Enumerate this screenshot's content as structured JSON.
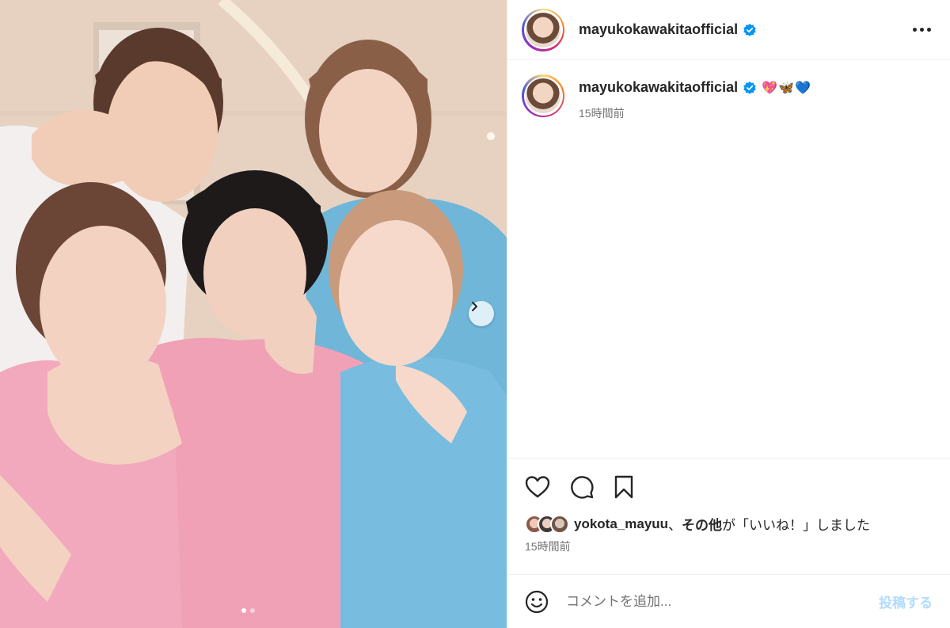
{
  "post": {
    "username": "mayukokawakitaofficial",
    "verified": true,
    "more_icon": "more-horizontal-icon"
  },
  "caption": {
    "username": "mayukokawakitaofficial",
    "text": "💖🦋💙",
    "time": "15時間前"
  },
  "media": {
    "image_alt": "photo",
    "slide_count": 2,
    "active_slide": 1
  },
  "actions": {
    "like_icon": "heart-icon",
    "comment_icon": "comment-icon",
    "save_icon": "bookmark-icon"
  },
  "likes": {
    "first_user": "yokota_mayuu",
    "separator": "、",
    "others": "その他",
    "suffix": "が「いいね！」しました",
    "time": "15時間前"
  },
  "comment": {
    "emoji_icon": "emoji-icon",
    "placeholder": "コメントを追加...",
    "post_label": "投稿する"
  },
  "colors": {
    "verified_blue": "#0095f6",
    "post_button_disabled": "#b3dbff",
    "secondary_text": "#737373"
  }
}
